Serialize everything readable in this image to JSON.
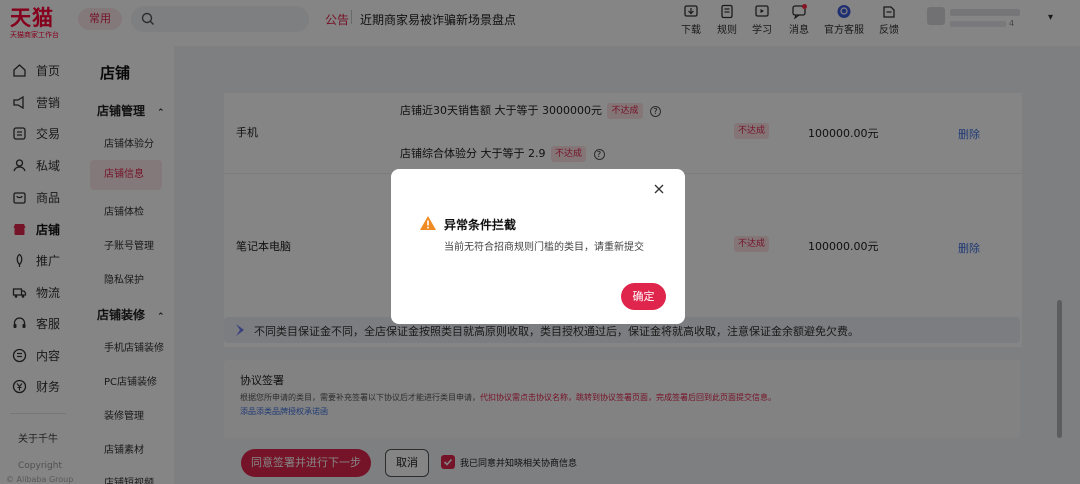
{
  "header": {
    "logo_main": "天猫",
    "logo_sub": "天猫商家工作台",
    "common_label": "常用",
    "notice_label": "公告",
    "notice_text": "近期商家易被诈骗新场景盘点",
    "tools": [
      {
        "label": "下载",
        "icon": "download-icon"
      },
      {
        "label": "规则",
        "icon": "rules-icon"
      },
      {
        "label": "学习",
        "icon": "learn-icon"
      },
      {
        "label": "消息",
        "icon": "message-icon"
      },
      {
        "label": "官方客服",
        "icon": "service-icon"
      },
      {
        "label": "反馈",
        "icon": "feedback-icon"
      }
    ],
    "user_id_suffix": "4"
  },
  "leftnav": {
    "items": [
      {
        "label": "首页",
        "icon": "home-icon"
      },
      {
        "label": "营销",
        "icon": "marketing-icon"
      },
      {
        "label": "交易",
        "icon": "trade-icon"
      },
      {
        "label": "私域",
        "icon": "private-icon"
      },
      {
        "label": "商品",
        "icon": "goods-icon"
      },
      {
        "label": "店铺",
        "icon": "store-icon"
      },
      {
        "label": "推广",
        "icon": "promote-icon"
      },
      {
        "label": "物流",
        "icon": "logistics-icon"
      },
      {
        "label": "客服",
        "icon": "support-icon"
      },
      {
        "label": "内容",
        "icon": "content-icon"
      },
      {
        "label": "财务",
        "icon": "finance-icon"
      }
    ],
    "about": "关于千牛",
    "copyright": "Copyright",
    "copyright2": "© Alibaba Group"
  },
  "subnav": {
    "title": "店铺",
    "group1": "店铺管理",
    "group1_items": [
      "店铺体验分",
      "店铺信息",
      "店铺体检",
      "子账号管理",
      "隐私保护"
    ],
    "group2": "店铺装修",
    "group2_items": [
      "手机店铺装修",
      "PC店铺装修",
      "装修管理",
      "店铺素材",
      "店铺短视频"
    ]
  },
  "table": {
    "rows": [
      {
        "category": "手机",
        "conditions": [
          {
            "text": "店铺近30天销售额 大于等于 3000000元",
            "tag": "不达成"
          },
          {
            "text": "店铺综合体验分 大于等于 2.9",
            "tag": "不达成"
          }
        ],
        "status": "不达成",
        "amount": "100000.00元",
        "action": "删除"
      },
      {
        "category": "笔记本电脑",
        "status": "不达成",
        "amount": "100000.00元",
        "action": "删除"
      }
    ]
  },
  "tip": "不同类目保证金不同，全店保证金按照类目就高原则收取，类目授权通过后，保证金将就高收取，注意保证金余额避免欠费。",
  "agreement": {
    "title": "协议签署",
    "desc_prefix": "根据您所申请的类目，需要补充签署以下协议后才能进行类目申请，",
    "desc_red": "代扣协议需点击协议名称，跳转到协议签署页面，完成签署后回到此页面提交信息。",
    "link": "添品添类品牌授权承诺函"
  },
  "actions": {
    "primary": "同意签署并进行下一步",
    "cancel": "取消",
    "checkbox_label": "我已同意并知晓相关协商信息"
  },
  "modal": {
    "title": "异常条件拦截",
    "message": "当前无符合招商规则门槛的类目，请重新提交",
    "ok": "确定"
  },
  "colors": {
    "brand": "#ff0036",
    "accent": "#e0254d",
    "link": "#3d6fe0"
  }
}
